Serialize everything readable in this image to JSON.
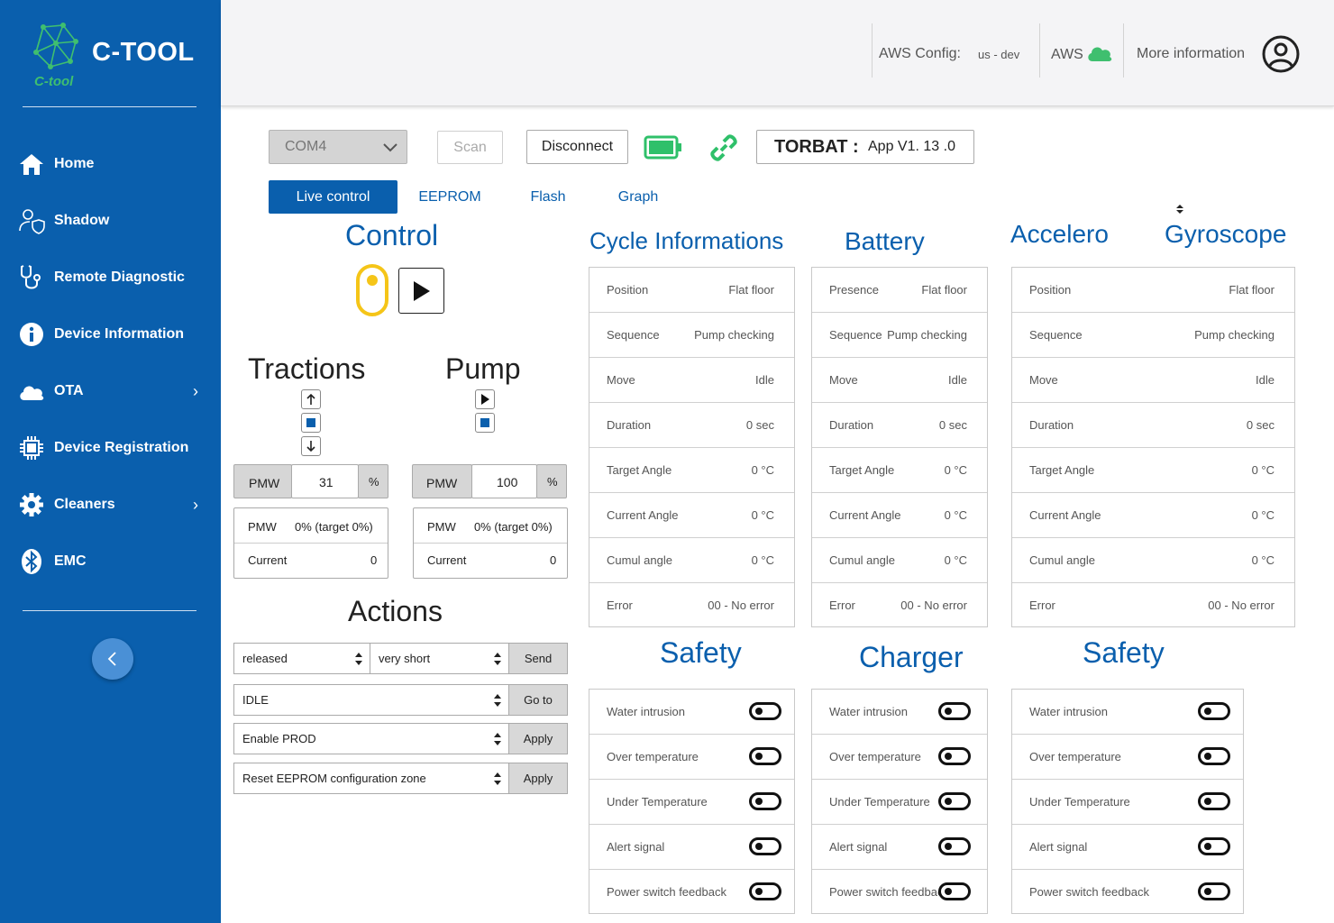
{
  "brand": {
    "name": "C-TOOL",
    "sub": "C-tool"
  },
  "nav": [
    {
      "label": "Home",
      "icon": "home-icon"
    },
    {
      "label": "Shadow",
      "icon": "user-shield-icon"
    },
    {
      "label": "Remote Diagnostic",
      "icon": "stethoscope-icon"
    },
    {
      "label": "Device Information",
      "icon": "info-icon"
    },
    {
      "label": "OTA",
      "icon": "cloud-icon"
    },
    {
      "label": "Device Registration",
      "icon": "chip-icon"
    },
    {
      "label": "Cleaners",
      "icon": "gear-icon"
    },
    {
      "label": "EMC",
      "icon": "bluetooth-icon"
    }
  ],
  "header": {
    "aws_config_label": "AWS Config:",
    "aws_config_value": "us - dev",
    "aws_label": "AWS",
    "more_info": "More information"
  },
  "toolbar": {
    "port": "COM4",
    "scan": "Scan",
    "disconnect": "Disconnect",
    "device_name": "TORBAT :",
    "app_version": "App V1. 13 .0"
  },
  "tabs": [
    "Live control",
    "EEPROM",
    "Flash",
    "Graph"
  ],
  "control": {
    "title": "Control",
    "tractions_title": "Tractions",
    "pump_title": "Pump",
    "tractions": {
      "pmw_label": "PMW",
      "pmw_value": "31",
      "unit": "%",
      "status_pmw_label": "PMW",
      "status_pmw_value": "0% (target 0%)",
      "current_label": "Current",
      "current_value": "0"
    },
    "pump": {
      "pmw_label": "PMW",
      "pmw_value": "100",
      "unit": "%",
      "status_pmw_label": "PMW",
      "status_pmw_value": "0% (target 0%)",
      "current_label": "Current",
      "current_value": "0"
    }
  },
  "actions": {
    "title": "Actions",
    "select1": "released",
    "select2": "very short",
    "send": "Send",
    "state": "IDLE",
    "goto": "Go to",
    "mode": "Enable PROD",
    "apply1": "Apply",
    "reset": "Reset EEPROM configuration zone",
    "apply2": "Apply"
  },
  "cycle": {
    "title": "Cycle Informations",
    "rows": [
      {
        "k": "Position",
        "v": "Flat floor"
      },
      {
        "k": "Sequence",
        "v": "Pump checking"
      },
      {
        "k": "Move",
        "v": "Idle"
      },
      {
        "k": "Duration",
        "v": "0 sec"
      },
      {
        "k": "Target Angle",
        "v": "0 °C"
      },
      {
        "k": "Current Angle",
        "v": "0 °C"
      },
      {
        "k": "Cumul angle",
        "v": "0 °C"
      },
      {
        "k": "Error",
        "v": "00 - No error"
      }
    ]
  },
  "battery": {
    "title": "Battery",
    "rows": [
      {
        "k": "Presence",
        "v": "Flat floor"
      },
      {
        "k": "Sequence",
        "v": "Pump checking"
      },
      {
        "k": "Move",
        "v": "Idle"
      },
      {
        "k": "Duration",
        "v": "0 sec"
      },
      {
        "k": "Target Angle",
        "v": "0 °C"
      },
      {
        "k": "Current Angle",
        "v": "0 °C"
      },
      {
        "k": "Cumul angle",
        "v": "0 °C"
      },
      {
        "k": "Error",
        "v": "00 - No error"
      }
    ]
  },
  "accelero": {
    "title1": "Accelero",
    "title2": "Gyroscope",
    "rows": [
      {
        "k": "Position",
        "v": "Flat floor"
      },
      {
        "k": "Sequence",
        "v": "Pump checking"
      },
      {
        "k": "Move",
        "v": "Idle"
      },
      {
        "k": "Duration",
        "v": "0 sec"
      },
      {
        "k": "Target Angle",
        "v": "0 °C"
      },
      {
        "k": "Current Angle",
        "v": "0 °C"
      },
      {
        "k": "Cumul angle",
        "v": "0 °C"
      },
      {
        "k": "Error",
        "v": "00 - No error"
      }
    ]
  },
  "safety1": {
    "title": "Safety",
    "rows": [
      "Water intrusion",
      "Over temperature",
      "Under Temperature",
      "Alert signal",
      "Power switch feedback"
    ]
  },
  "charger": {
    "title": "Charger",
    "rows": [
      "Water intrusion",
      "Over temperature",
      "Under Temperature",
      "Alert signal",
      "Power switch feedback"
    ]
  },
  "safety2": {
    "title": "Safety",
    "rows": [
      "Water intrusion",
      "Over temperature",
      "Under Temperature",
      "Alert signal",
      "Power switch feedback"
    ]
  },
  "colors": {
    "primary": "#0a5fad",
    "accent_green": "#3fbf6f",
    "battery_green": "#2fc06a",
    "toggle_yellow": "#f5c518"
  }
}
